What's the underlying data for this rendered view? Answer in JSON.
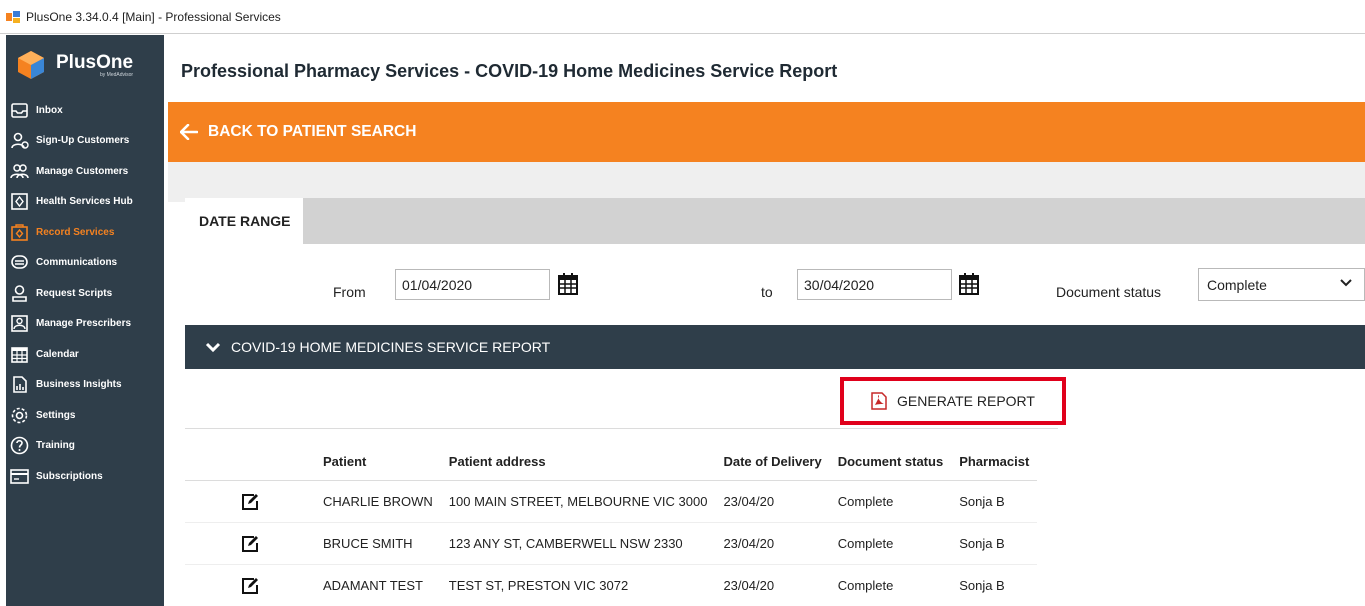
{
  "window": {
    "title": "PlusOne 3.34.0.4 [Main] - Professional Services"
  },
  "logo": {
    "name": "PlusOne",
    "sub": "by MedAdvisor"
  },
  "sidebar": {
    "items": [
      {
        "label": "Inbox",
        "icon": "inbox-icon"
      },
      {
        "label": "Sign-Up Customers",
        "icon": "sign-up-customers-icon"
      },
      {
        "label": "Manage Customers",
        "icon": "manage-customers-icon"
      },
      {
        "label": "Health Services Hub",
        "icon": "health-services-icon"
      },
      {
        "label": "Record Services",
        "icon": "record-services-icon",
        "active": true
      },
      {
        "label": "Communications",
        "icon": "communications-icon"
      },
      {
        "label": "Request Scripts",
        "icon": "request-scripts-icon"
      },
      {
        "label": "Manage Prescribers",
        "icon": "manage-prescribers-icon"
      },
      {
        "label": "Calendar",
        "icon": "calendar-icon"
      },
      {
        "label": "Business Insights",
        "icon": "business-insights-icon"
      },
      {
        "label": "Settings",
        "icon": "settings-icon"
      },
      {
        "label": "Training",
        "icon": "training-icon"
      },
      {
        "label": "Subscriptions",
        "icon": "subscriptions-icon"
      }
    ]
  },
  "page": {
    "title": "Professional Pharmacy Services - COVID-19 Home Medicines Service Report",
    "back_label": "BACK TO PATIENT SEARCH",
    "tab_label": "DATE RANGE"
  },
  "filters": {
    "from_label": "From",
    "from_value": "01/04/2020",
    "to_label": "to",
    "to_value": "30/04/2020",
    "status_label": "Document status",
    "status_value": "Complete"
  },
  "report": {
    "section_title": "COVID-19 HOME MEDICINES SERVICE REPORT",
    "generate_label": "GENERATE REPORT",
    "columns": [
      "Patient",
      "Patient address",
      "Date of Delivery",
      "Document status",
      "Pharmacist"
    ],
    "rows": [
      [
        "CHARLIE BROWN",
        "100 MAIN STREET, MELBOURNE VIC 3000",
        "23/04/20",
        "Complete",
        "Sonja B"
      ],
      [
        "BRUCE SMITH",
        "123 ANY ST, CAMBERWELL NSW 2330",
        "23/04/20",
        "Complete",
        "Sonja B"
      ],
      [
        "ADAMANT TEST",
        "TEST ST, PRESTON VIC 3072",
        "23/04/20",
        "Complete",
        "Sonja B"
      ]
    ]
  },
  "colors": {
    "brand_orange": "#f58220",
    "sidebar_bg": "#2f3e4a",
    "highlight_red": "#e0001b"
  }
}
